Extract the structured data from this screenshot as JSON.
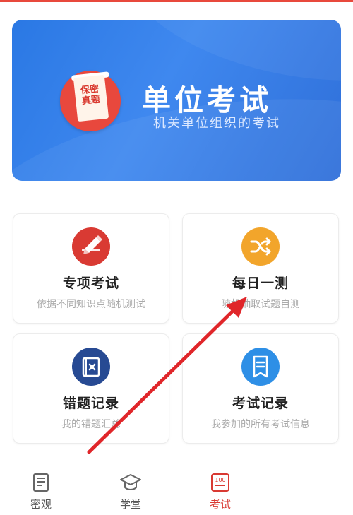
{
  "banner": {
    "badge_line1": "保密",
    "badge_line2": "真题",
    "title": "单位考试",
    "subtitle": "机关单位组织的考试"
  },
  "cards": [
    {
      "title": "专项考试",
      "desc": "依据不同知识点随机测试",
      "icon": "pencil-icon",
      "color": "#d93a33"
    },
    {
      "title": "每日一测",
      "desc": "随机抽取试题自测",
      "icon": "shuffle-icon",
      "color": "#f2a52b"
    },
    {
      "title": "错题记录",
      "desc": "我的错题汇总",
      "icon": "wrong-book-icon",
      "color": "#274a93"
    },
    {
      "title": "考试记录",
      "desc": "我参加的所有考试信息",
      "icon": "record-doc-icon",
      "color": "#2e8fe6"
    }
  ],
  "tabs": [
    {
      "label": "密观",
      "icon": "news-icon"
    },
    {
      "label": "学堂",
      "icon": "graduation-cap-icon"
    },
    {
      "label": "考试",
      "icon": "exam-100-icon",
      "active": true,
      "badge": "100"
    }
  ],
  "annotation": {
    "arrow_color": "#e0262a"
  }
}
